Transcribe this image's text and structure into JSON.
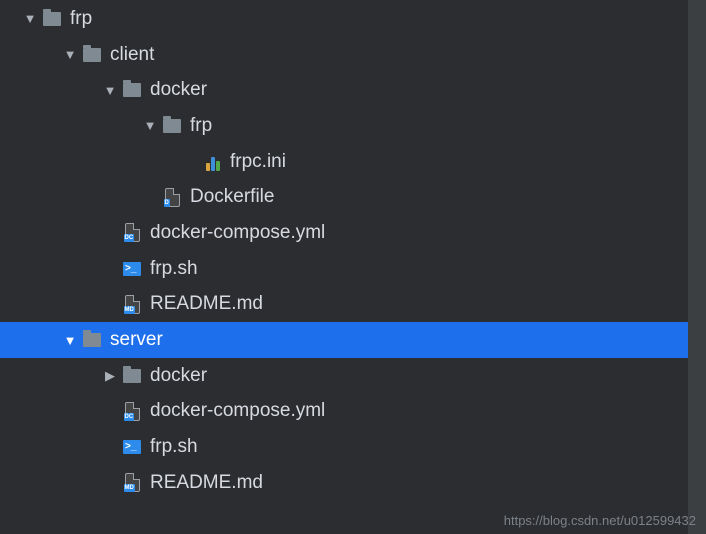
{
  "indent": 40,
  "base_pad": 20,
  "watermark": "https://blog.csdn.net/u012599432",
  "rows": [
    {
      "depth": 0,
      "expanded": true,
      "icon": "folder",
      "label": "frp",
      "interactable": true,
      "selected": false
    },
    {
      "depth": 1,
      "expanded": true,
      "icon": "folder",
      "label": "client",
      "interactable": true,
      "selected": false
    },
    {
      "depth": 2,
      "expanded": true,
      "icon": "folder",
      "label": "docker",
      "interactable": true,
      "selected": false
    },
    {
      "depth": 3,
      "expanded": true,
      "icon": "folder",
      "label": "frp",
      "interactable": true,
      "selected": false
    },
    {
      "depth": 4,
      "expanded": null,
      "icon": "ini",
      "label": "frpc.ini",
      "interactable": true,
      "selected": false
    },
    {
      "depth": 3,
      "expanded": null,
      "icon": "file-d",
      "label": "Dockerfile",
      "interactable": true,
      "selected": false
    },
    {
      "depth": 2,
      "expanded": null,
      "icon": "file-dc",
      "label": "docker-compose.yml",
      "interactable": true,
      "selected": false
    },
    {
      "depth": 2,
      "expanded": null,
      "icon": "sh",
      "label": "frp.sh",
      "interactable": true,
      "selected": false
    },
    {
      "depth": 2,
      "expanded": null,
      "icon": "file-md",
      "label": "README.md",
      "interactable": true,
      "selected": false
    },
    {
      "depth": 1,
      "expanded": true,
      "icon": "folder",
      "label": "server",
      "interactable": true,
      "selected": true
    },
    {
      "depth": 2,
      "expanded": false,
      "icon": "folder",
      "label": "docker",
      "interactable": true,
      "selected": false
    },
    {
      "depth": 2,
      "expanded": null,
      "icon": "file-dc",
      "label": "docker-compose.yml",
      "interactable": true,
      "selected": false
    },
    {
      "depth": 2,
      "expanded": null,
      "icon": "sh",
      "label": "frp.sh",
      "interactable": true,
      "selected": false
    },
    {
      "depth": 2,
      "expanded": null,
      "icon": "file-md",
      "label": "README.md",
      "interactable": true,
      "selected": false
    }
  ]
}
